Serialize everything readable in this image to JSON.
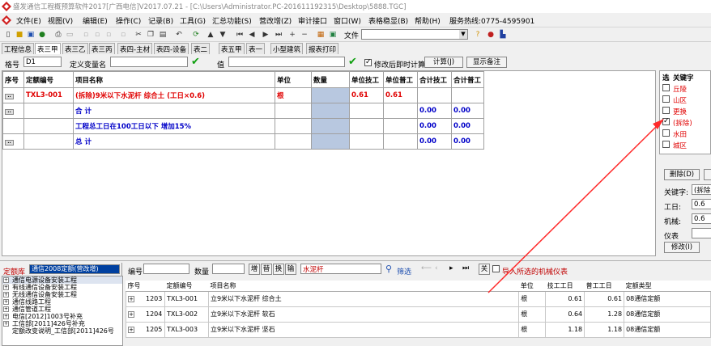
{
  "window": {
    "title": "盛发通信工程概预算软件2017[广西电信]V2017.07.21 - [C:\\Users\\Administrator.PC-201611192315\\Desktop\\5888.TGC]"
  },
  "menu": [
    "文件(E)",
    "视图(V)",
    "编辑(E)",
    "操作(C)",
    "记录(B)",
    "工具(G)",
    "汇总功能(S)",
    "营改增(Z)",
    "审计接口",
    "窗口(W)",
    "表格稳显(B)",
    "帮助(H)",
    "服务热线:0775-4595901"
  ],
  "toolbar": {
    "file_label": "文件"
  },
  "tabs": [
    "工程信息",
    "表三甲",
    "表三乙",
    "表三丙",
    "表四-主材",
    "表四-设备",
    "表二",
    "表五甲",
    "表一",
    "小型建筑",
    "报表打印"
  ],
  "formula_bar": {
    "cell_label": "格号",
    "cell_value": "D1",
    "define_var_label": "定义变量名",
    "value_label": "值",
    "auto_calc_label": "修改后即时计算",
    "calc_button": "计算(J)",
    "show_note_button": "显示备注"
  },
  "main_table": {
    "headers": [
      "序号",
      "定额编号",
      "项目名称",
      "单位",
      "数量",
      "单位技工",
      "单位普工",
      "合计技工",
      "合计普工"
    ],
    "rows": [
      {
        "btn": "..",
        "code": "TXL3-001",
        "name": "(拆除)9米以下水泥杆 综合土 (工日×0.6)",
        "unit": "根",
        "qty": "",
        "u_tech": "0.61",
        "u_gen": "0.61",
        "t_tech": "",
        "t_gen": "",
        "style": "red"
      },
      {
        "btn": "..",
        "code": "",
        "name": "合   计",
        "unit": "",
        "qty": "",
        "u_tech": "",
        "u_gen": "",
        "t_tech": "0.00",
        "t_gen": "0.00",
        "style": "blue"
      },
      {
        "btn": "",
        "code": "",
        "name": "工程总工日在100工日以下 增加15%",
        "unit": "",
        "qty": "",
        "u_tech": "",
        "u_gen": "",
        "t_tech": "0.00",
        "t_gen": "0.00",
        "style": "blue"
      },
      {
        "btn": "..",
        "code": "",
        "name": "总   计",
        "unit": "",
        "qty": "",
        "u_tech": "",
        "u_gen": "",
        "t_tech": "0.00",
        "t_gen": "0.00",
        "style": "blue"
      }
    ]
  },
  "right_panel": {
    "headers": [
      "选",
      "关键字"
    ],
    "items": [
      {
        "label": "丘陵",
        "checked": false
      },
      {
        "label": "山区",
        "checked": false
      },
      {
        "label": "更换",
        "checked": false
      },
      {
        "label": "(拆除)",
        "checked": true
      },
      {
        "label": "水田",
        "checked": false
      },
      {
        "label": "城区",
        "checked": false
      }
    ],
    "delete_button": "删除(D)",
    "keyword_label": "关键字:",
    "keyword_value": "(拆除",
    "labor_label": "工日:",
    "labor_value": "0.6",
    "machine_label": "机械:",
    "machine_value": "0.6",
    "instrument_label": "仪表",
    "modify_button": "修改(I)"
  },
  "library": {
    "label": "定额库",
    "selected": "通信2008定额(营改增)",
    "code_label": "编号",
    "qty_label": "数量",
    "add_button": "增",
    "replace_button": "替",
    "swap_button": "换",
    "insert_button": "输",
    "search_value": "水泥杆",
    "filter_label": "筛选",
    "close_button": "关",
    "import_machine_label": "导入所选的机械仪表"
  },
  "tree": [
    "通信电源设备安装工程",
    "有线通信设备安装工程",
    "无线通信设备安装工程",
    "通信线路工程",
    "通信管道工程",
    "电信[2012]1003号补充",
    "工信部[2011]426号补充",
    "定额改变说明_工信部[2011]426号"
  ],
  "lib_table": {
    "headers": [
      "序号",
      "定额编号",
      "项目名称",
      "单位",
      "技工工日",
      "普工工日",
      "定额类型"
    ],
    "rows": [
      {
        "no": "1203",
        "code": "TXL3-001",
        "name": "立9米以下水泥杆 综合土",
        "unit": "根",
        "tech": "0.61",
        "gen": "0.61",
        "type": "08通信定额"
      },
      {
        "no": "1204",
        "code": "TXL3-002",
        "name": "立9米以下水泥杆 软石",
        "unit": "根",
        "tech": "0.64",
        "gen": "1.28",
        "type": "08通信定额"
      },
      {
        "no": "1205",
        "code": "TXL3-003",
        "name": "立9米以下水泥杆 坚石",
        "unit": "根",
        "tech": "1.18",
        "gen": "1.18",
        "type": "08通信定额"
      }
    ]
  }
}
